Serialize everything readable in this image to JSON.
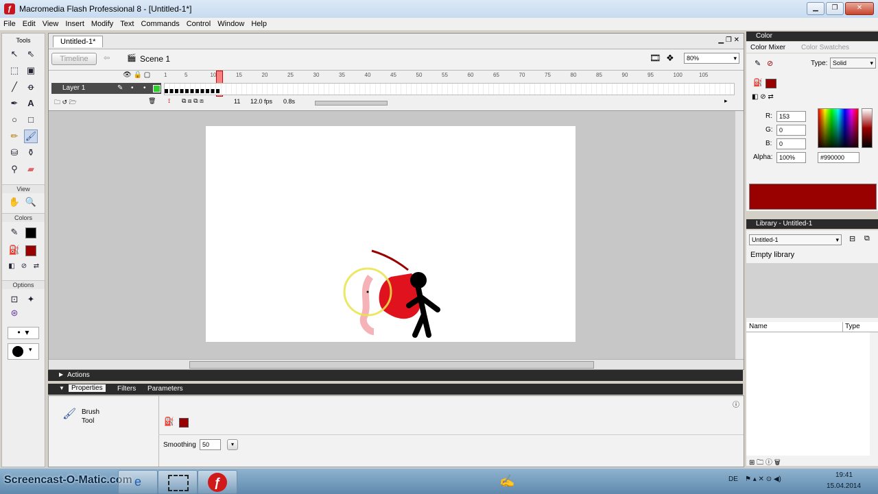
{
  "window": {
    "title": "Macromedia Flash Professional 8 - [Untitled-1*]",
    "app_icon": "flash-icon"
  },
  "menu": [
    "File",
    "Edit",
    "View",
    "Insert",
    "Modify",
    "Text",
    "Commands",
    "Control",
    "Window",
    "Help"
  ],
  "toolbox": {
    "title": "Tools",
    "view_label": "View",
    "colors_label": "Colors",
    "options_label": "Options"
  },
  "document": {
    "tab": "Untitled-1*",
    "timeline_button": "Timeline",
    "scene": "Scene 1",
    "zoom": "80%"
  },
  "timeline": {
    "frame_numbers": [
      "1",
      "5",
      "10",
      "15",
      "20",
      "25",
      "30",
      "35",
      "40",
      "45",
      "50",
      "55",
      "60",
      "65",
      "70",
      "75",
      "80",
      "85",
      "90",
      "95",
      "100",
      "105"
    ],
    "layer_name": "Layer 1",
    "current_frame": "11",
    "fps": "12.0 fps",
    "elapsed": "0.8s"
  },
  "panels": {
    "actions": "Actions",
    "properties_tabs": [
      "Properties",
      "Filters",
      "Parameters"
    ],
    "tool_name_line1": "Brush",
    "tool_name_line2": "Tool",
    "smoothing_label": "Smoothing",
    "smoothing_value": "50"
  },
  "color": {
    "panel_title": "Color",
    "tabs": [
      "Color Mixer",
      "Color Swatches"
    ],
    "type_label": "Type:",
    "type_value": "Solid",
    "r_label": "R:",
    "r": "153",
    "g_label": "G:",
    "g": "0",
    "b_label": "B:",
    "b": "0",
    "alpha_label": "Alpha:",
    "alpha": "100%",
    "hex": "#990000",
    "fill_color": "#990000"
  },
  "library": {
    "panel_title": "Library - Untitled-1",
    "doc": "Untitled-1",
    "empty": "Empty library",
    "col_name": "Name",
    "col_type": "Type"
  },
  "taskbar": {
    "watermark": "Screencast-O-Matic.com",
    "lang": "DE",
    "time": "19:41",
    "date": "15.04.2014"
  }
}
